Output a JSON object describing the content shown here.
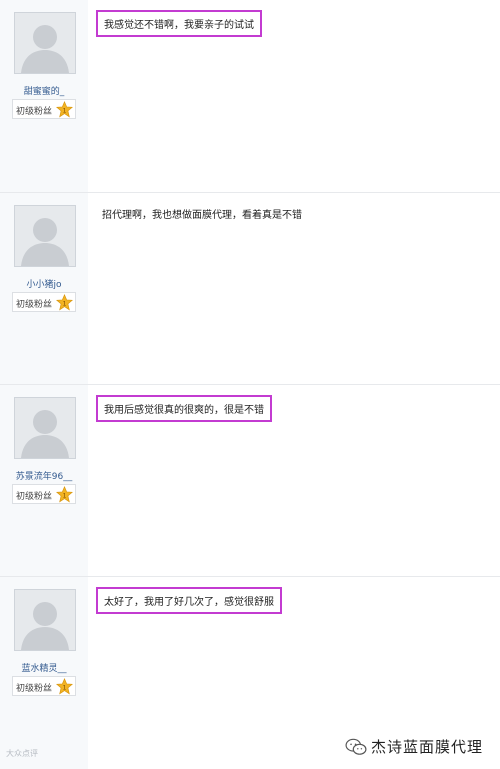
{
  "posts": [
    {
      "username": "甜蜜蜜的_",
      "rank": "初级粉丝",
      "message": "我感觉还不错啊，我要亲子的试试",
      "highlighted": true
    },
    {
      "username": "小小猪jo",
      "rank": "初级粉丝",
      "message": "招代理啊，我也想做面膜代理，看着真是不错",
      "highlighted": false
    },
    {
      "username": "苏景流年96__",
      "rank": "初级粉丝",
      "message": "我用后感觉很真的很爽的，很是不错",
      "highlighted": true
    },
    {
      "username": "蓝水精灵__",
      "rank": "初级粉丝",
      "message": "太好了，我用了好几次了，感觉很舒服",
      "highlighted": true
    }
  ],
  "watermark_left": "大众点评",
  "watermark_right": "杰诗蓝面膜代理",
  "colors": {
    "highlight_border": "#c33bd1",
    "username": "#335a8f",
    "star": "#f2b323"
  },
  "icons": {
    "avatar": "default-avatar-icon",
    "rank": "star-badge-icon",
    "watermark": "wechat-icon"
  }
}
